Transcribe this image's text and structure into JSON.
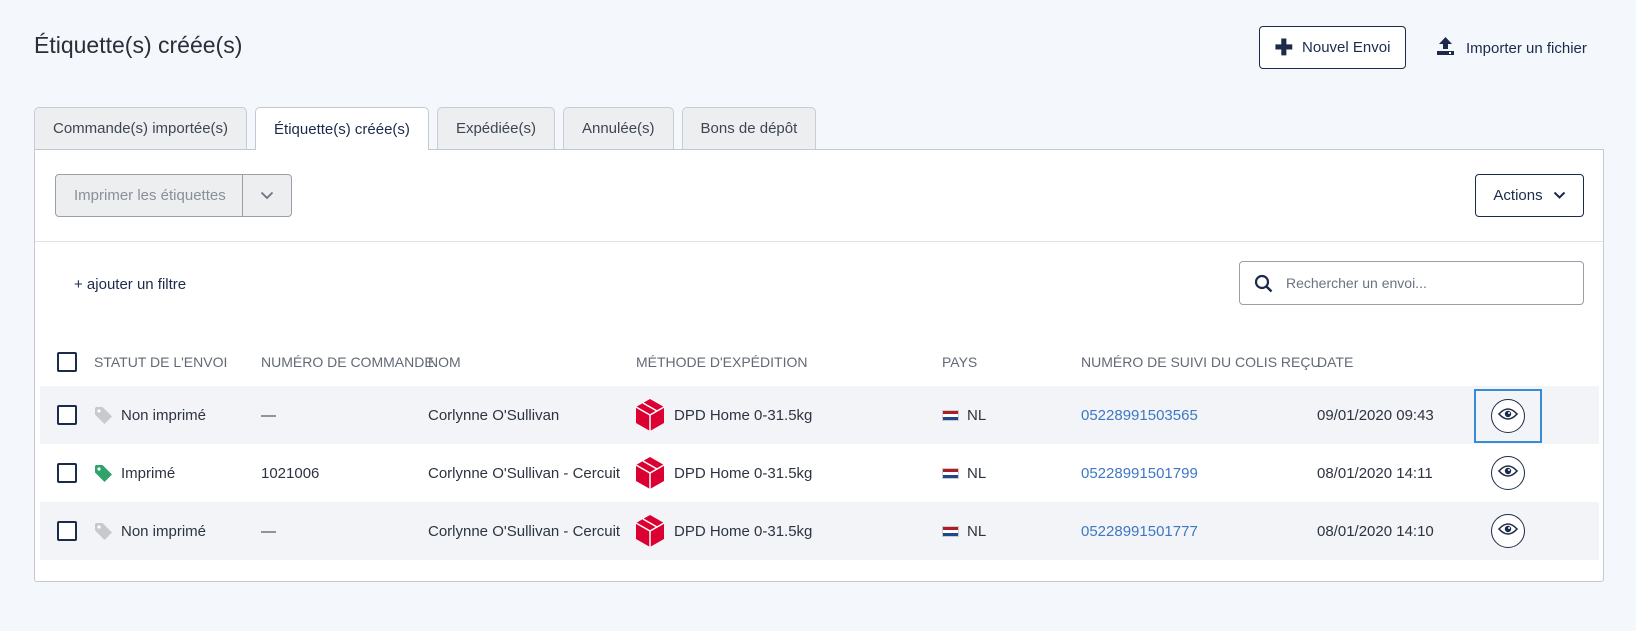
{
  "header": {
    "title": "Étiquette(s) créée(s)",
    "new_button": "Nouvel Envoi",
    "import_button": "Importer un fichier"
  },
  "tabs": [
    {
      "label": "Commande(s) importée(s)",
      "active": false
    },
    {
      "label": "Étiquette(s) créée(s)",
      "active": true
    },
    {
      "label": "Expédiée(s)",
      "active": false
    },
    {
      "label": "Annulée(s)",
      "active": false
    },
    {
      "label": "Bons de dépôt",
      "active": false
    }
  ],
  "toolbar": {
    "print_label": "Imprimer les étiquettes",
    "actions_label": "Actions"
  },
  "filter": {
    "add_filter": "+ ajouter un filtre",
    "search_placeholder": "Rechercher un envoi..."
  },
  "table": {
    "columns": [
      "Statut de l'envoi",
      "Numéro de commande",
      "Nom",
      "Méthode d'expédition",
      "Pays",
      "Numéro de suivi du colis reçu",
      "Date"
    ],
    "rows": [
      {
        "status": "Non imprimé",
        "printed": false,
        "order": "—",
        "name": "Corlynne O'Sullivan",
        "method": "DPD Home 0-31.5kg",
        "country": "NL",
        "tracking": "05228991503565",
        "date": "09/01/2020 09:43"
      },
      {
        "status": "Imprimé",
        "printed": true,
        "order": "1021006",
        "name": "Corlynne O'Sullivan - Cercuit",
        "method": "DPD Home 0-31.5kg",
        "country": "NL",
        "tracking": "05228991501799",
        "date": "08/01/2020 14:11"
      },
      {
        "status": "Non imprimé",
        "printed": false,
        "order": "—",
        "name": "Corlynne O'Sullivan - Cercuit",
        "method": "DPD Home 0-31.5kg",
        "country": "NL",
        "tracking": "05228991501777",
        "date": "08/01/2020 14:10"
      }
    ]
  },
  "colors": {
    "navy": "#1c2b4a",
    "link": "#3d78c4",
    "tag_printed": "#2fa36b",
    "tag_unprinted": "#c7c9cc",
    "dpd_red": "#dc0032",
    "focus": "#3a8bd6"
  },
  "icons": {
    "new": "plus-icon",
    "import": "upload-icon",
    "search": "search-icon",
    "view": "eye-icon",
    "status": "tag-icon",
    "carrier": "dpd-logo",
    "flag": "nl-flag"
  }
}
